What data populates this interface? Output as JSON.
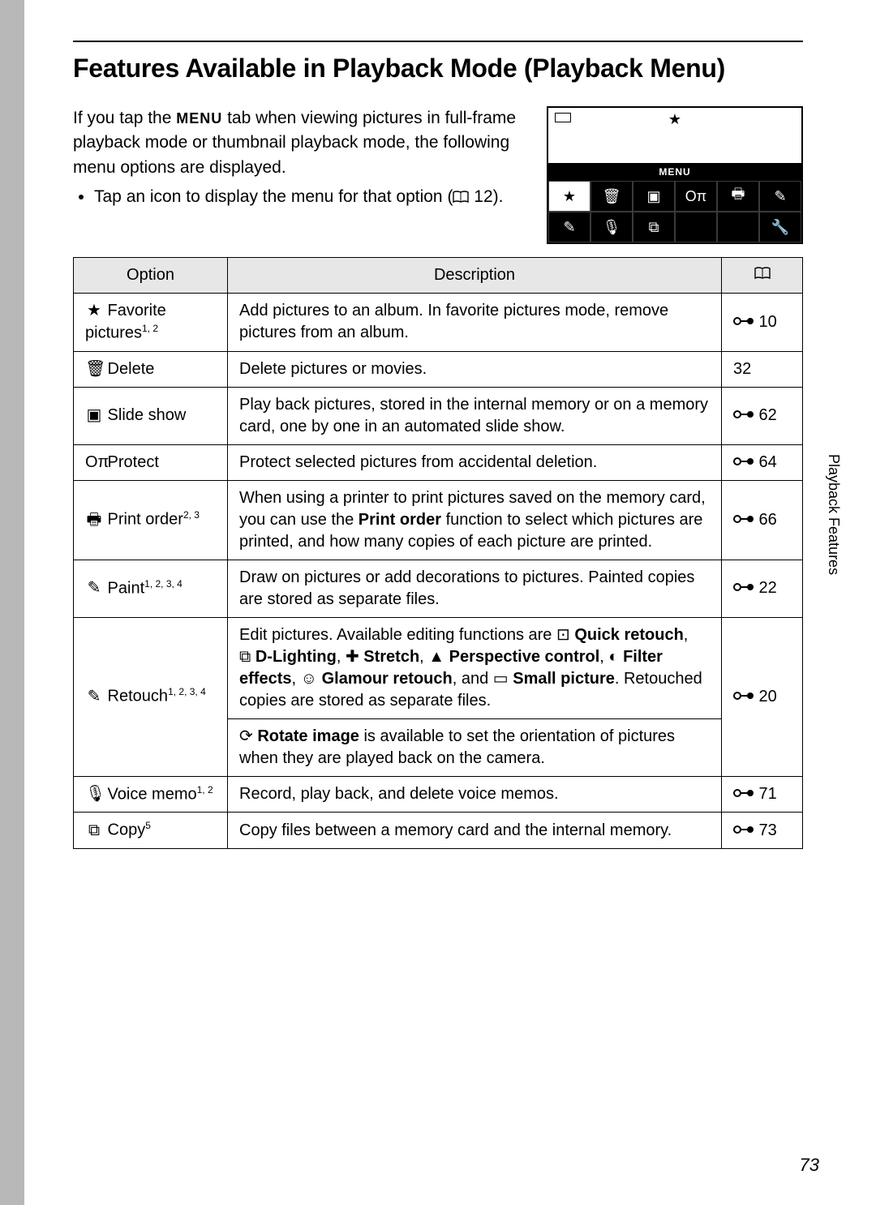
{
  "title": "Features Available in Playback Mode (Playback Menu)",
  "intro": {
    "p1a": "If you tap the ",
    "menu_word": "MENU",
    "p1b": " tab when viewing pictures in full-frame playback mode or thumbnail playback mode, the following menu options are displayed.",
    "bullet_a": "Tap an icon to display the menu for that option (",
    "bullet_ref": " 12).",
    "book_glyph": "▯▯"
  },
  "preview": {
    "menu_label": "MENU",
    "row1_icons": [
      "★",
      "🗑",
      "▣",
      "Oπ",
      "🖶",
      "✎"
    ],
    "row2_icons": [
      "✎",
      "🎙",
      "⧉",
      "",
      "",
      "🔧"
    ]
  },
  "headers": {
    "option": "Option",
    "description": "Description",
    "ref_glyph": "▯▯"
  },
  "rows": [
    {
      "icon": "★",
      "name_a": "Favorite",
      "name_b": "pictures",
      "sup": "1, 2",
      "desc": "Add pictures to an album. In favorite pictures mode, remove pictures from an album.",
      "ref_icon": "�còn",
      "ref": "10",
      "ref_has_icon": true
    },
    {
      "icon": "🗑",
      "name_a": "Delete",
      "name_b": "",
      "sup": "",
      "desc": "Delete pictures or movies.",
      "ref": "32",
      "ref_has_icon": false
    },
    {
      "icon": "▣",
      "name_a": "Slide show",
      "name_b": "",
      "sup": "",
      "desc": "Play back pictures, stored in the internal memory or on a memory card, one by one in an automated slide show.",
      "ref": "62",
      "ref_has_icon": true
    },
    {
      "icon": "Oπ",
      "name_a": "Protect",
      "name_b": "",
      "sup": "",
      "desc": "Protect selected pictures from accidental deletion.",
      "ref": "64",
      "ref_has_icon": true
    },
    {
      "icon": "🖶",
      "name_a": "Print order",
      "name_b": "",
      "sup": "2, 3",
      "desc_parts": [
        "When using a printer to print pictures saved on the memory card, you can use the ",
        "Print order",
        " function to select which pictures are printed, and how many copies of each picture are printed."
      ],
      "ref": "66",
      "ref_has_icon": true
    },
    {
      "icon": "✎",
      "name_a": "Paint",
      "name_b": "",
      "sup": "1, 2, 3, 4",
      "desc": "Draw on pictures or add decorations to pictures. Painted copies are stored as separate files.",
      "ref": "22",
      "ref_has_icon": true
    },
    {
      "icon": "✎",
      "name_a": "Retouch",
      "name_b": "",
      "sup": "1, 2, 3, 4",
      "retouch_intro": "Edit pictures. Available editing functions are ",
      "retouch_items": [
        "Quick retouch",
        "D-Lighting",
        "Stretch",
        "Perspective control",
        "Filter effects",
        "Glamour retouch",
        "Small picture"
      ],
      "retouch_item_icons": [
        "⊡",
        "⧉",
        "✚",
        "▲",
        "◐",
        "☺",
        "▭"
      ],
      "retouch_outro_a": ". Retouched copies are stored as separate files.",
      "retouch_second_a": "Rotate image",
      "retouch_second_b": " is available to set the orientation of pictures when they are played back on the camera.",
      "retouch_second_icon": "⟳",
      "ref": "20",
      "ref_has_icon": true
    },
    {
      "icon": "🎙",
      "name_a": "Voice memo",
      "name_b": "",
      "sup": "1, 2",
      "desc": "Record, play back, and delete voice memos.",
      "ref": "71",
      "ref_has_icon": true
    },
    {
      "icon": "⧉",
      "name_a": "Copy",
      "name_b": "",
      "sup": "5",
      "desc": "Copy files between a memory card and the internal memory.",
      "ref": "73",
      "ref_has_icon": true
    }
  ],
  "side_label": "Playback Features",
  "page_number": "73",
  "ref_link_glyph": "☍"
}
